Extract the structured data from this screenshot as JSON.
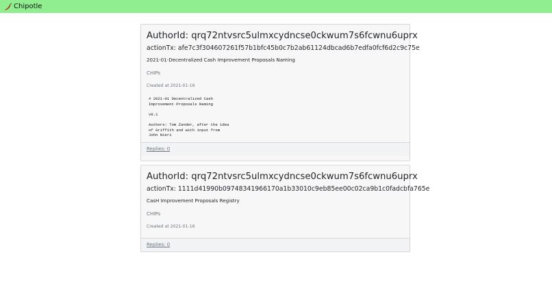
{
  "navbar": {
    "brand": "Chipotle"
  },
  "posts": [
    {
      "author": "AuthorId: qrq72ntvsrc5ulmxcydncse0ckwum7s6fcwnu6uprx",
      "action_tx": "actionTx: afe7c3f304607261f57b1bfc45b0c7b2ab61124dbcad6b7edfa0fcf6d2c9c75e",
      "title": "2021-01-Decentralized Cash Improvement Proposals Naming",
      "category": "CHIPs",
      "created": "Created at 2021-01-16",
      "content": "# 2021-01 Decentralized Cash\nImprovement Proposals Naming\n\nv0.1\n\nAuthors: Tom Zander, after the idea\nof Griffith and with input from\nJohn Nieri",
      "replies": "Replies: 0"
    },
    {
      "author": "AuthorId: qrq72ntvsrc5ulmxcydncse0ckwum7s6fcwnu6uprx",
      "action_tx": "actionTx: 1111d41990b09748341966170a1b33010c9eb85ee00c02ca9b1c0fadcbfa765e",
      "title": "CasH Improvement Proposals Registry",
      "category": "CHIPs",
      "created": "Created at 2021-01-16",
      "replies": "Replies: 0"
    }
  ]
}
